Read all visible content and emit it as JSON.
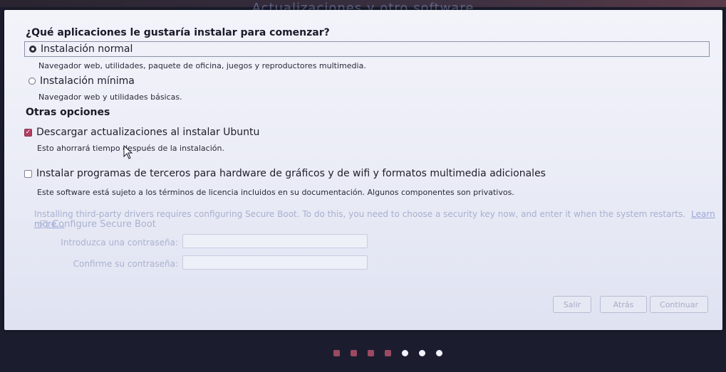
{
  "window": {
    "title": "Actualizaciones y otro software"
  },
  "question": "¿Qué aplicaciones le gustaría instalar para comenzar?",
  "install_options": [
    {
      "label": "Instalación normal",
      "description": "Navegador web, utilidades, paquete de oficina, juegos y reproductores multimedia.",
      "selected": true
    },
    {
      "label": "Instalación mínima",
      "description": "Navegador web y utilidades básicas.",
      "selected": false
    }
  ],
  "other_options": {
    "heading": "Otras opciones",
    "download_updates": {
      "label": "Descargar actualizaciones al instalar Ubuntu",
      "description": "Esto ahorrará tiempo después de la instalación.",
      "checked": true
    },
    "third_party": {
      "label": "Instalar programas de terceros para hardware de gráficos y de wifi y formatos multimedia adicionales",
      "description": "Este software está sujeto a los términos de licencia incluidos en su documentación. Algunos componentes son privativos.",
      "checked": false
    }
  },
  "secure_boot": {
    "note": "Installing third-party drivers requires configuring Secure Boot. To do this, you need to choose a security key now, and enter it when the system restarts.",
    "learn_more": "Learn more...",
    "configure_label": "Configure Secure Boot",
    "password_label": "Introduzca una contraseña:",
    "confirm_label": "Confirme su contraseña:",
    "password_value": "",
    "confirm_value": ""
  },
  "buttons": {
    "quit": "Salir",
    "back": "Atrás",
    "continue": "Continuar"
  },
  "progress": {
    "steps_total": 7,
    "steps_done": 4
  },
  "colors": {
    "accent": "#b04060",
    "text": "#1e1e2c",
    "disabled_text": "#a9b1cf"
  },
  "icons": {
    "cursor": "mouse-pointer-icon"
  }
}
